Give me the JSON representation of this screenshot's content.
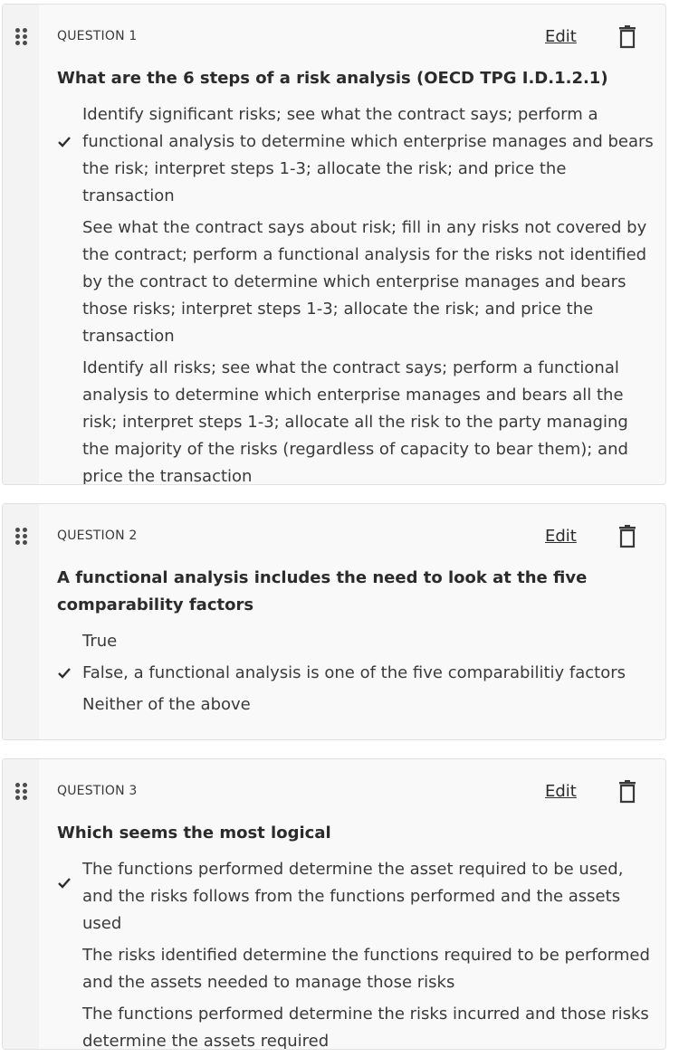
{
  "actions": {
    "edit_label": "Edit"
  },
  "questions": [
    {
      "label": "QUESTION 1",
      "text": "What are the 6 steps of a risk analysis (OECD TPG I.D.1.2.1)",
      "answers": [
        {
          "text": "Identify significant risks; see what the contract says; perform a functional analysis to determine which enterprise manages and bears the risk; interpret steps 1-3; allocate the risk; and price the transaction",
          "correct": true
        },
        {
          "text": "See what the contract says about risk; fill in any risks not covered by the contract; perform a functional analysis for the risks not identified by the contract to determine which enterprise manages and bears those risks; interpret steps 1-3; allocate the risk; and price the transaction",
          "correct": false
        },
        {
          "text": "Identify all risks; see what the contract says; perform a functional analysis to determine which enterprise manages and bears all the risk; interpret steps 1-3; allocate all the risk to the party managing the majority of the risks (regardless of capacity to bear them); and price the transaction",
          "correct": false
        }
      ]
    },
    {
      "label": "QUESTION 2",
      "text": "A functional analysis includes the need to look at the five comparability factors",
      "answers": [
        {
          "text": "True",
          "correct": false
        },
        {
          "text": "False, a functional analysis is one of the five comparabilitiy factors",
          "correct": true
        },
        {
          "text": "Neither of the above",
          "correct": false
        }
      ]
    },
    {
      "label": "QUESTION 3",
      "text": "Which seems the most logical",
      "answers": [
        {
          "text": "The functions performed determine the asset required to be used, and the risks follows from the functions performed and the assets used",
          "correct": true
        },
        {
          "text": "The risks identified determine the functions required to be performed and the assets needed to manage those risks",
          "correct": false
        },
        {
          "text": "The functions performed determine the risks incurred and those risks determine the assets required",
          "correct": false
        }
      ]
    }
  ]
}
